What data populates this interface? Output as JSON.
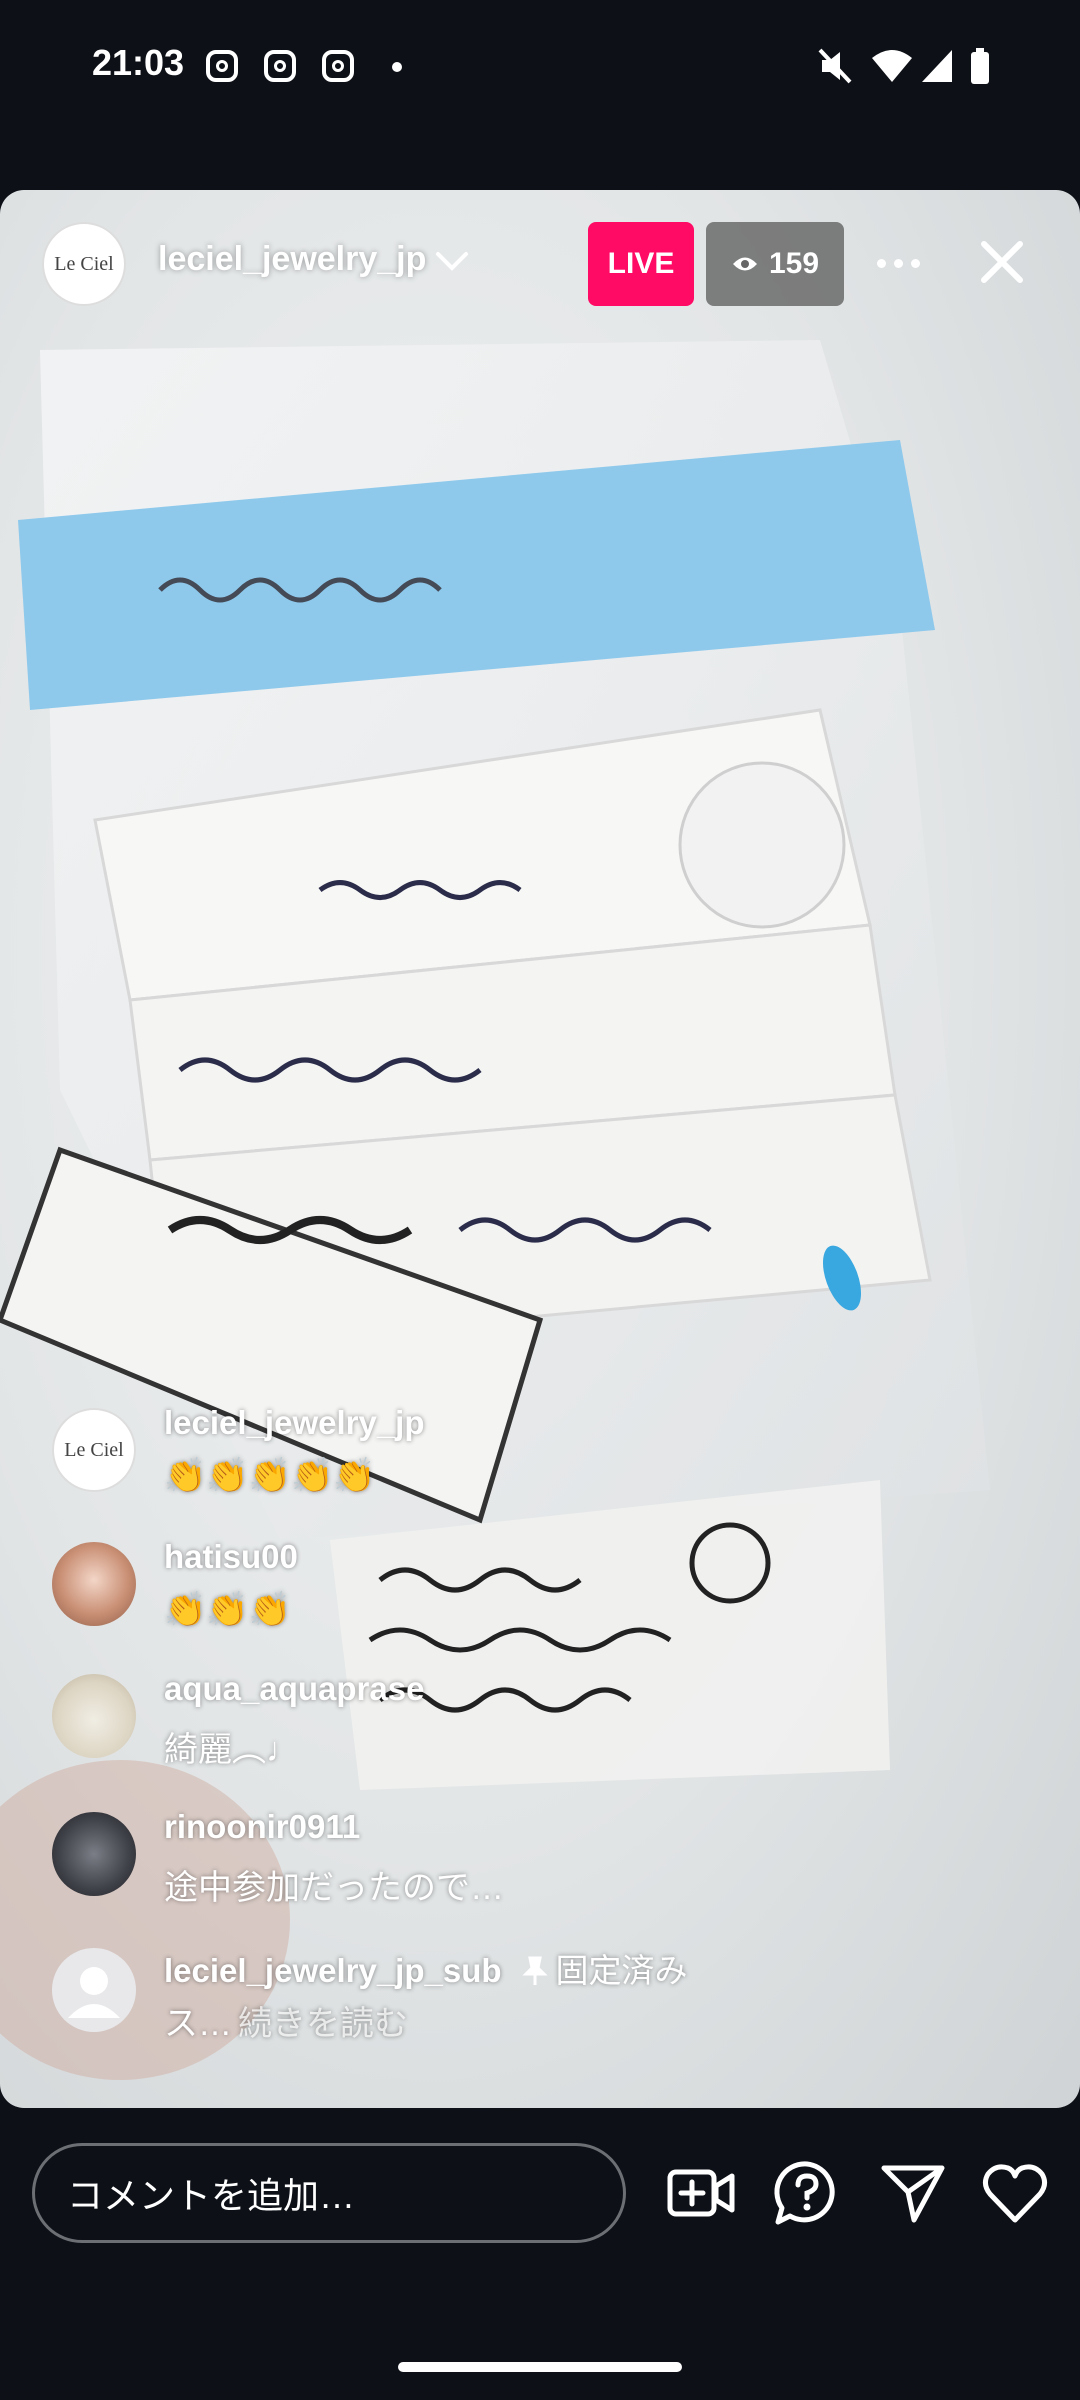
{
  "status_bar": {
    "time": "21:03"
  },
  "live": {
    "host": "leciel_jewelry_jp",
    "host_avatar_text": "Le Ciel",
    "live_label": "LIVE",
    "viewer_count": "159"
  },
  "comments": [
    {
      "user": "leciel_jewelry_jp",
      "text": "👏👏👏👏👏",
      "avatar_text": "Le Ciel"
    },
    {
      "user": "hatisu00",
      "text": "👏👏👏"
    },
    {
      "user": "aqua_aquaprase",
      "text": "綺麗︵♩"
    },
    {
      "user": "rinoonir0911",
      "text": "途中参加だったので…"
    },
    {
      "user": "leciel_jewelry_jp_sub",
      "pinned_label": "固定済み",
      "text": "ス…",
      "read_more": "続きを読む"
    }
  ],
  "bottom": {
    "input_placeholder": "コメントを追加…"
  }
}
